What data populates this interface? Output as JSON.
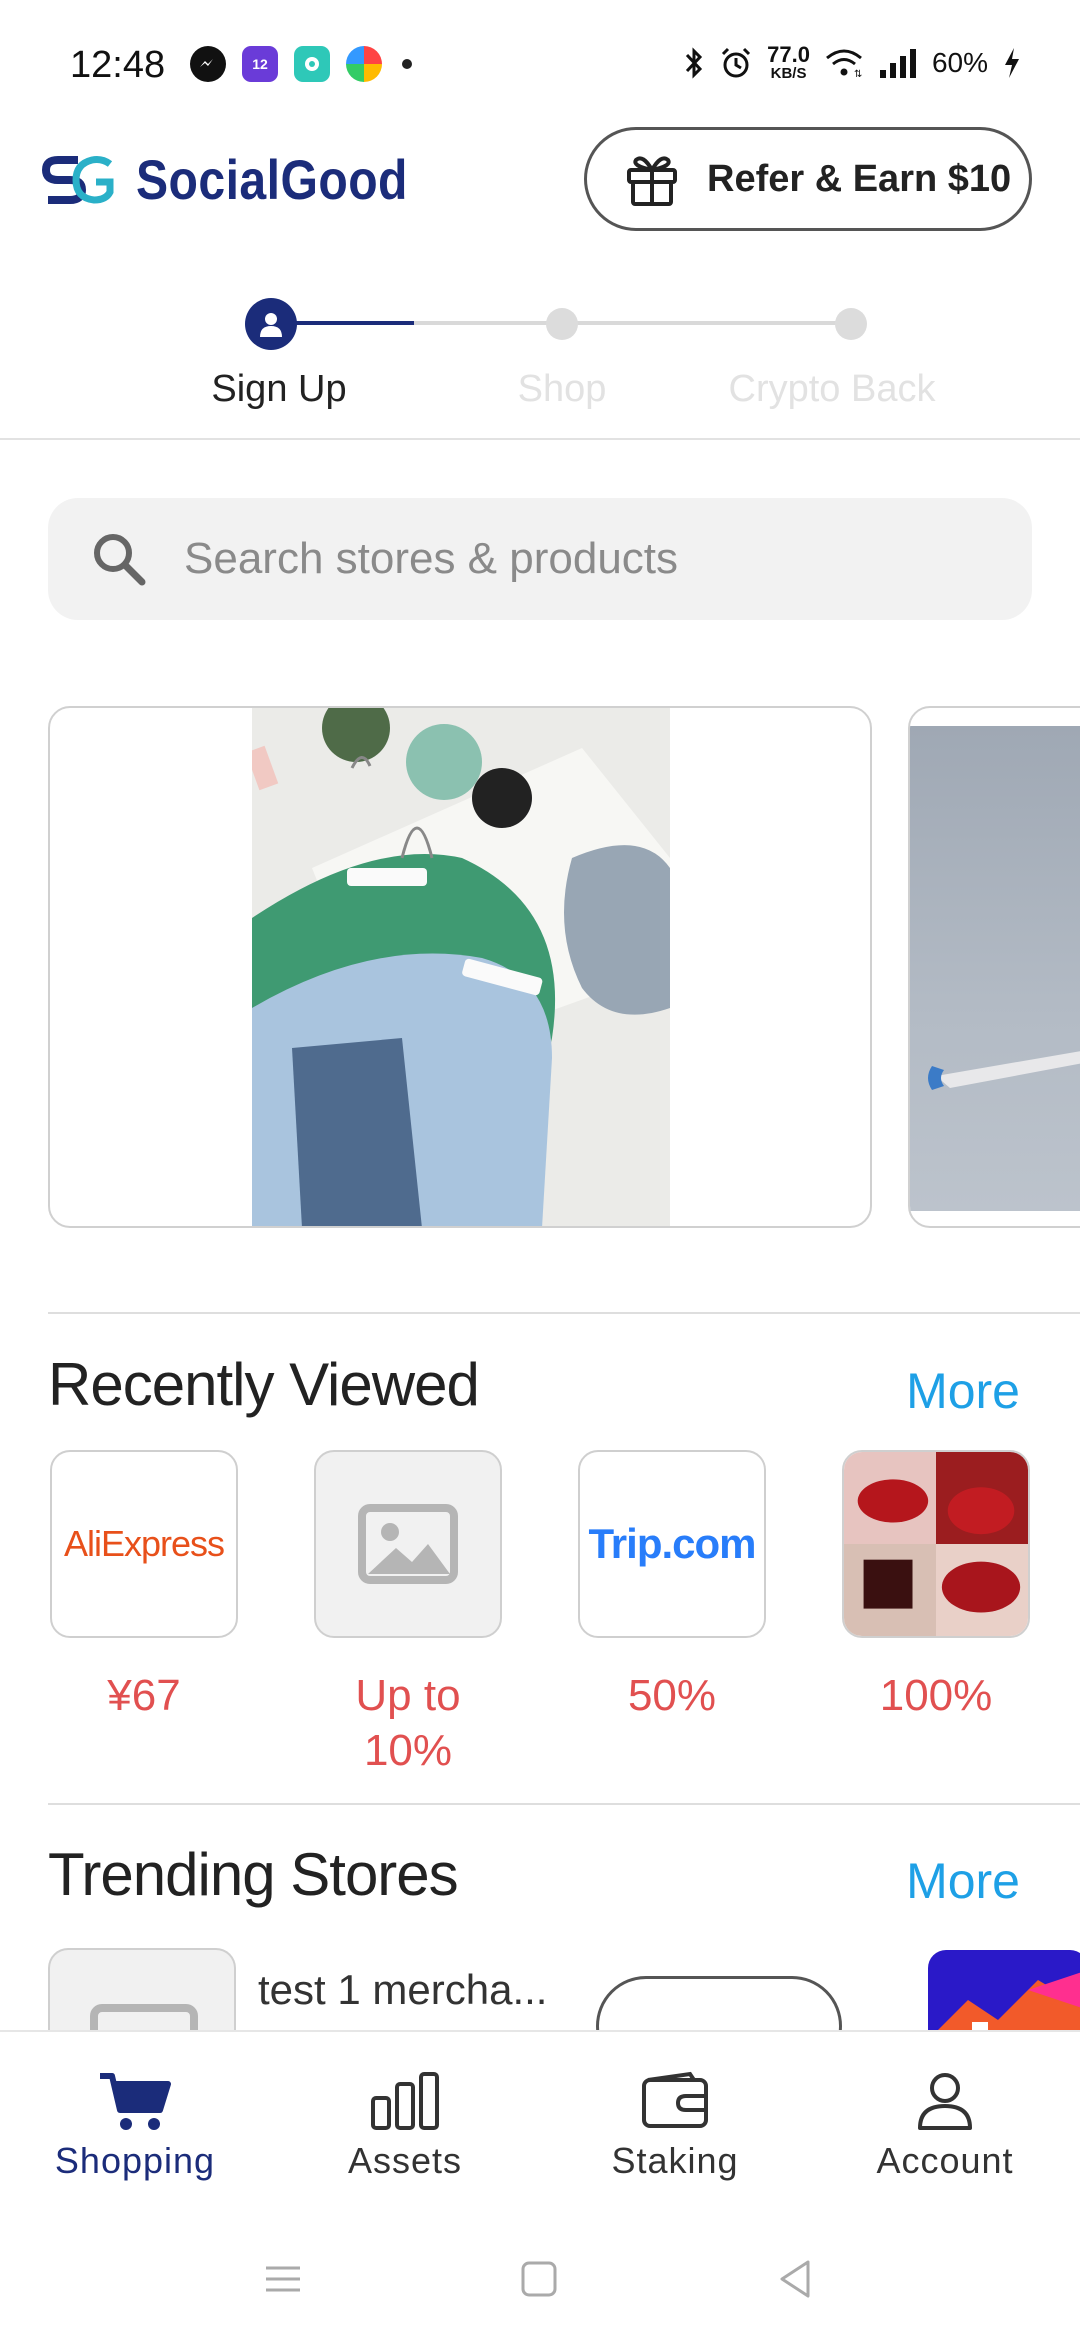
{
  "status_bar": {
    "time": "12:48",
    "net_speed_value": "77.0",
    "net_speed_unit": "KB/S",
    "battery": "60%"
  },
  "header": {
    "brand": "SocialGood",
    "refer_label": "Refer & Earn $10"
  },
  "stepper": {
    "steps": [
      {
        "label": "Sign Up",
        "active": true
      },
      {
        "label": "Shop",
        "active": false
      },
      {
        "label": "Crypto Back",
        "active": false
      }
    ]
  },
  "search": {
    "placeholder": "Search stores & products"
  },
  "recently_viewed": {
    "title": "Recently Viewed",
    "more": "More",
    "items": [
      {
        "logo_text": "AliExpress",
        "value": "¥67"
      },
      {
        "logo_text": "",
        "value": "Up to 10%"
      },
      {
        "logo_text": "Trip.com",
        "value": "50%"
      },
      {
        "logo_text": "",
        "value": "100%"
      }
    ]
  },
  "trending": {
    "title": "Trending Stores",
    "more": "More",
    "first_store_name": "test 1 mercha..."
  },
  "bottom_nav": {
    "items": [
      {
        "label": "Shopping",
        "icon": "cart-icon",
        "active": true
      },
      {
        "label": "Assets",
        "icon": "bar-chart-icon",
        "active": false
      },
      {
        "label": "Staking",
        "icon": "wallet-icon",
        "active": false
      },
      {
        "label": "Account",
        "icon": "person-icon",
        "active": false
      }
    ]
  },
  "colors": {
    "brand_navy": "#1b2c7a",
    "link_blue": "#1ea0e6",
    "price_red": "#e15050"
  }
}
